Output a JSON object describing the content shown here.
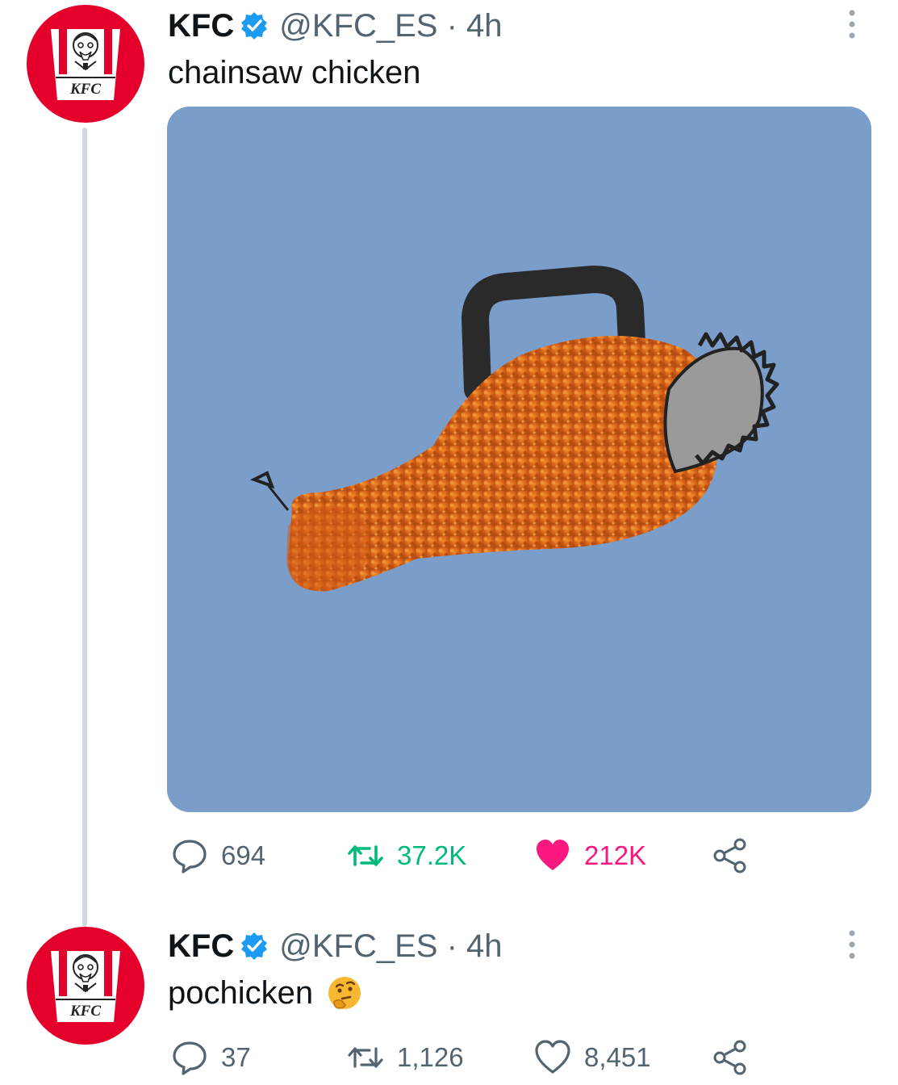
{
  "tweets": [
    {
      "display_name": "KFC",
      "handle": "@KFC_ES",
      "separator": "·",
      "time": "4h",
      "text": "chainsaw chicken",
      "avatar_logo_text": "KFC",
      "has_media": true,
      "media_icon": "chainsaw-chicken-image",
      "stats": {
        "replies": "694",
        "retweets": "37.2K",
        "likes": "212K"
      },
      "retweeted": true,
      "liked": true
    },
    {
      "display_name": "KFC",
      "handle": "@KFC_ES",
      "separator": "·",
      "time": "4h",
      "text": "pochicken",
      "emoji": "thinking-face",
      "avatar_logo_text": "KFC",
      "has_media": false,
      "stats": {
        "replies": "37",
        "retweets": "1,126",
        "likes": "8,451"
      },
      "retweeted": false,
      "liked": false
    }
  ],
  "colors": {
    "kfc_red": "#e4002b",
    "verified_blue": "#1d9bf0",
    "retweet_green": "#00ba7c",
    "like_pink": "#f91880",
    "muted_gray": "#536471",
    "thread_line": "#cfd9de",
    "media_background": "#7a9dc9"
  },
  "icons": {
    "reply": "reply-icon",
    "retweet": "retweet-icon",
    "like": "heart-icon",
    "share": "share-icon",
    "more": "more-vertical-icon",
    "verified": "verified-badge-icon"
  }
}
